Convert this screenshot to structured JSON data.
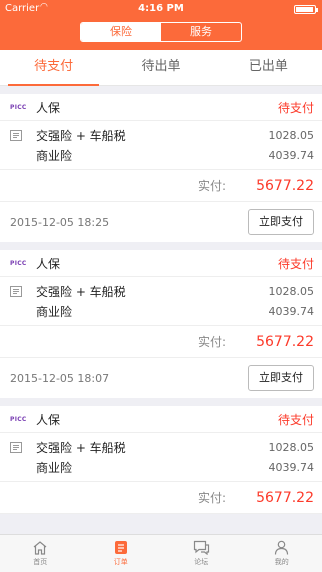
{
  "status_bar": {
    "carrier": "Carrier",
    "time": "4:16 PM",
    "battery_level": 0.95
  },
  "segment": [
    {
      "label": "保险",
      "active": true
    },
    {
      "label": "服务",
      "active": false
    }
  ],
  "tabs": [
    {
      "label": "待支付",
      "active": true
    },
    {
      "label": "待出单",
      "active": false
    },
    {
      "label": "已出单",
      "active": false
    }
  ],
  "orders": [
    {
      "logo": "PICC",
      "company": "人保",
      "status": "待支付",
      "items": [
        {
          "name": "交强险 + 车船税",
          "price": "1028.05"
        },
        {
          "name": "商业险",
          "price": "4039.74"
        }
      ],
      "paid_label": "实付:",
      "paid_amount": "5677.22",
      "date": "2015-12-05 18:25",
      "button": "立即支付"
    },
    {
      "logo": "PICC",
      "company": "人保",
      "status": "待支付",
      "items": [
        {
          "name": "交强险 + 车船税",
          "price": "1028.05"
        },
        {
          "name": "商业险",
          "price": "4039.74"
        }
      ],
      "paid_label": "实付:",
      "paid_amount": "5677.22",
      "date": "2015-12-05 18:07",
      "button": "立即支付"
    },
    {
      "logo": "PICC",
      "company": "人保",
      "status": "待支付",
      "items": [
        {
          "name": "交强险 + 车船税",
          "price": "1028.05"
        },
        {
          "name": "商业险",
          "price": "4039.74"
        }
      ],
      "paid_label": "实付:",
      "paid_amount": "5677.22",
      "date": "",
      "button": ""
    }
  ],
  "bottom_nav": [
    {
      "label": "首页",
      "icon": "home-icon",
      "active": false
    },
    {
      "label": "订单",
      "icon": "order-icon",
      "active": true
    },
    {
      "label": "论坛",
      "icon": "forum-icon",
      "active": false
    },
    {
      "label": "我的",
      "icon": "profile-icon",
      "active": false
    }
  ],
  "colors": {
    "accent": "#fc6a3a",
    "price_red": "#fc3a2a"
  }
}
